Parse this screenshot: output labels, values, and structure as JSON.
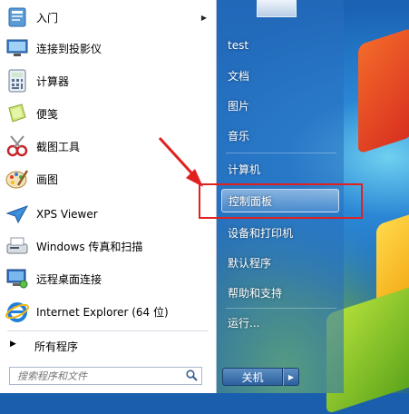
{
  "start_menu": {
    "programs": [
      {
        "label": "入门",
        "icon": "getting-started-icon",
        "has_submenu": true
      },
      {
        "label": "连接到投影仪",
        "icon": "projector-icon"
      },
      {
        "label": "计算器",
        "icon": "calculator-icon"
      },
      {
        "label": "便笺",
        "icon": "sticky-notes-icon"
      },
      {
        "label": "截图工具",
        "icon": "snipping-tool-icon"
      },
      {
        "label": "画图",
        "icon": "paint-icon"
      },
      {
        "label": "XPS Viewer",
        "icon": "xps-viewer-icon"
      },
      {
        "label": "Windows 传真和扫描",
        "icon": "fax-scan-icon"
      },
      {
        "label": "远程桌面连接",
        "icon": "remote-desktop-icon"
      },
      {
        "label": "Internet Explorer (64 位)",
        "icon": "internet-explorer-icon"
      }
    ],
    "all_programs": "所有程序",
    "search": {
      "placeholder": "搜索程序和文件",
      "value": ""
    },
    "right_items": [
      {
        "label": "test"
      },
      {
        "label": "文档"
      },
      {
        "label": "图片"
      },
      {
        "label": "音乐"
      },
      {
        "label": "计算机"
      },
      {
        "label": "控制面板",
        "highlighted": true
      },
      {
        "label": "设备和打印机"
      },
      {
        "label": "默认程序"
      },
      {
        "label": "帮助和支持"
      },
      {
        "label": "运行..."
      }
    ],
    "shutdown_label": "关机"
  },
  "colors": {
    "annotation": "#e12020",
    "right_pane": "#2f6fb8",
    "left_pane": "#ffffff"
  }
}
